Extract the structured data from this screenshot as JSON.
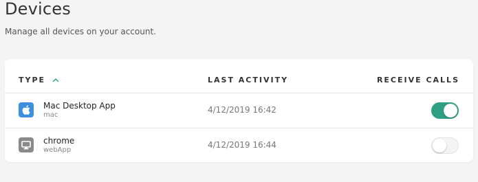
{
  "page": {
    "title": "Devices",
    "subtitle": "Manage all devices on your account."
  },
  "table": {
    "headers": {
      "type": "TYPE",
      "last_activity": "LAST ACTIVITY",
      "receive_calls": "RECEIVE CALLS"
    },
    "sort": {
      "column": "type",
      "direction": "ascending",
      "icon": "chevron-up-icon"
    },
    "rows": [
      {
        "icon": "apple-icon",
        "name": "Mac Desktop App",
        "sub": "mac",
        "last_activity": "4/12/2019 16:42",
        "receive_calls": true
      },
      {
        "icon": "monitor-icon",
        "name": "chrome",
        "sub": "webApp",
        "last_activity": "4/12/2019 16:44",
        "receive_calls": false
      }
    ]
  },
  "colors": {
    "accent": "#2e9f84",
    "mac_icon_bg": "#3d8fe0",
    "web_icon_bg": "#8a8a8a",
    "background": "#f4f4f4"
  }
}
